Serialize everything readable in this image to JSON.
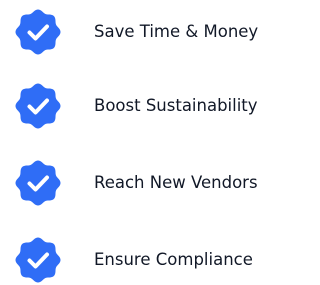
{
  "colors": {
    "badge": "#2f6df6",
    "check": "#ffffff",
    "text": "#111827"
  },
  "icon": "verified-check-badge-icon",
  "items": [
    {
      "label": "Save Time & Money"
    },
    {
      "label": "Boost Sustainability"
    },
    {
      "label": "Reach New Vendors"
    },
    {
      "label": "Ensure Compliance"
    }
  ]
}
